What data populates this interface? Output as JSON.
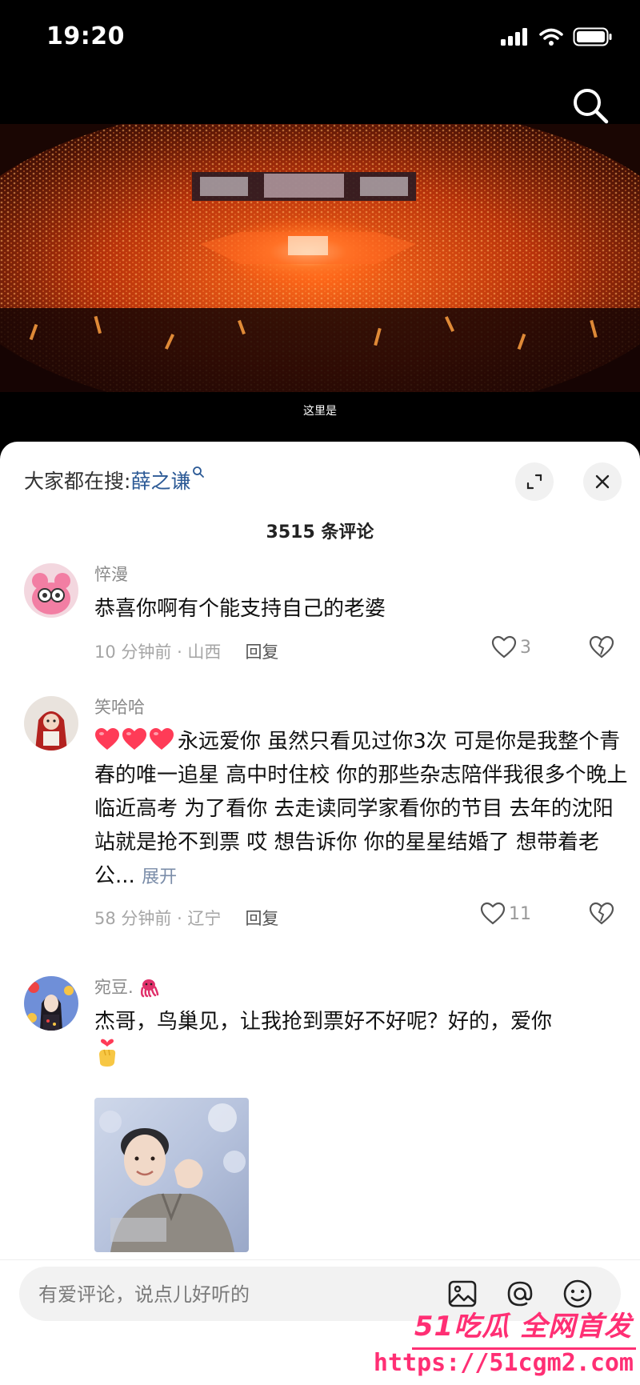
{
  "status_bar": {
    "time": "19:20"
  },
  "video": {
    "caption": "这里是"
  },
  "trending": {
    "prefix": "大家都在搜:",
    "keyword": "薛之谦"
  },
  "comments_header": {
    "count_text": "3515 条评论"
  },
  "comments": [
    {
      "username": "悴漫",
      "text": "恭喜你啊有个能支持自己的老婆",
      "time_location": "10 分钟前 · 山西",
      "reply_label": "回复",
      "likes": "3"
    },
    {
      "username": "笑哈哈",
      "text": "永远爱你 虽然只看见过你3次 可是你是我整个青春的唯一追星 高中时住校 你的那些杂志陪伴我很多个晚上 临近高考 为了看你 去走读同学家看你的节目 去年的沈阳站就是抢不到票 哎 想告诉你 你的星星结婚了 想带着老公...",
      "expand_label": "展开",
      "time_location": "58 分钟前 · 辽宁",
      "reply_label": "回复",
      "likes": "11"
    },
    {
      "username": "宛豆.",
      "text": "杰哥，鸟巢见，让我抢到票好不好呢？好的，爱你"
    }
  ],
  "input_bar": {
    "placeholder": "有爱评论，说点儿好听的"
  },
  "watermark": {
    "brand": "51吃瓜 全网首发",
    "url": "https://51cgm2.com"
  },
  "colors": {
    "accent_link": "#2c5a96",
    "watermark": "#ff2f74",
    "heart": "#ff3b57"
  }
}
